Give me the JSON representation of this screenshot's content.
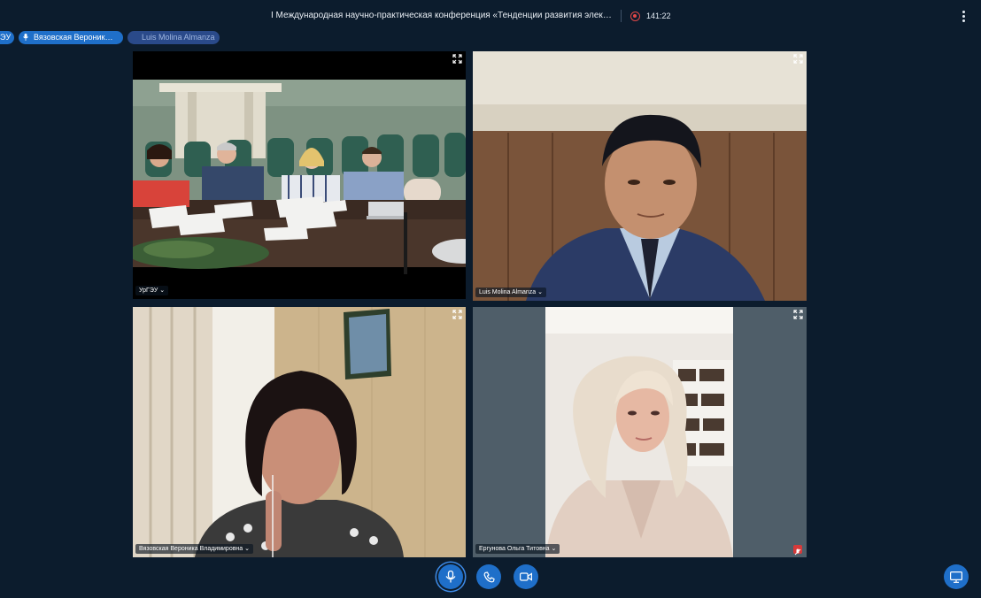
{
  "header": {
    "title": "I Международная научно-практическая конференция «Тенденции развития электронно…",
    "recording_time": "141:22",
    "menu_icon": "kebab-icon"
  },
  "talkers": [
    {
      "label": "ЭУ"
    },
    {
      "label": "Вязовская Вероник…",
      "icon": "microphone-icon"
    },
    {
      "label": "Luis Molina Almanza"
    }
  ],
  "videos": [
    {
      "name": "УрГЭУ ⌄"
    },
    {
      "name": "Luis Molina Almanza ⌄"
    },
    {
      "name": "Вязовская Вероника Владимировна ⌄"
    },
    {
      "name": "Ергунова Ольга Титовна ⌄",
      "muted": true
    }
  ],
  "controls": {
    "mic": "microphone-icon",
    "phone": "phone-icon",
    "camera": "camera-icon",
    "screen_share": "screen-share-icon"
  },
  "colors": {
    "background": "#0c1c2d",
    "accent": "#1f6fc9",
    "recording": "#e04848"
  }
}
